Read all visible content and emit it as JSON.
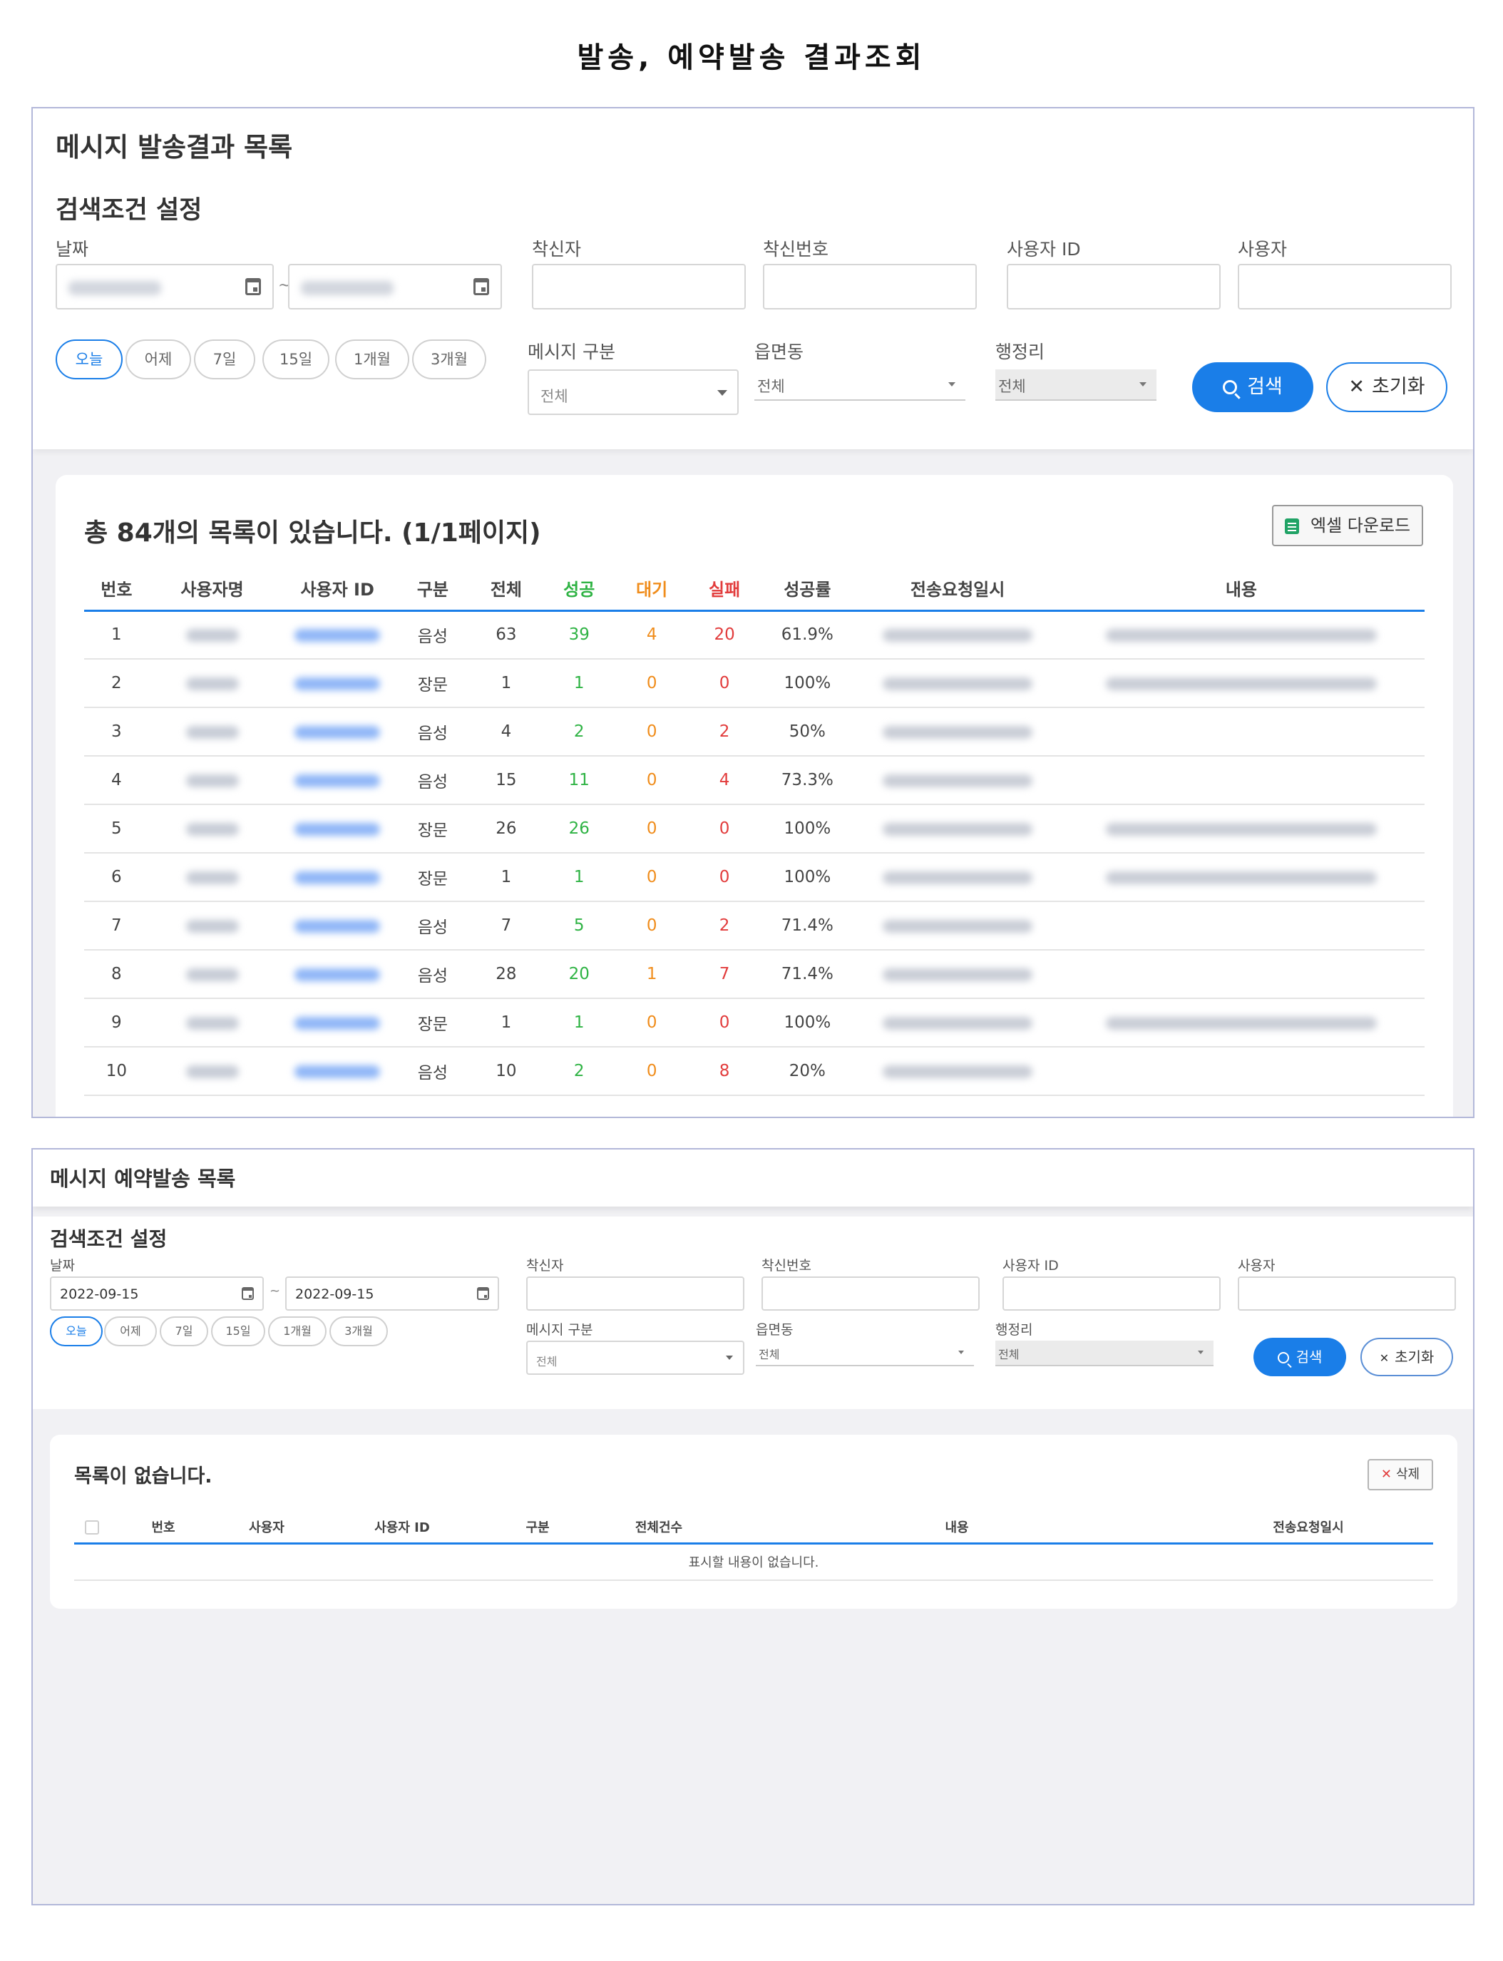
{
  "doc_title": "발송, 예약발송 결과조회",
  "sent": {
    "list_title": "메시지 발송결과 목록",
    "cond_title": "검색조건 설정",
    "labels": {
      "date": "날짜",
      "receiver": "착신자",
      "receiver_no": "착신번호",
      "user_id": "사용자 ID",
      "user": "사용자",
      "msg_type": "메시지 구분",
      "town": "읍면동",
      "village": "행정리"
    },
    "date_sep": "~",
    "quick_ranges": [
      "오늘",
      "어제",
      "7일",
      "15일",
      "1개월",
      "3개월"
    ],
    "selects": {
      "msg_type": "전체",
      "town": "전체",
      "village": "전체"
    },
    "search_label": "검색",
    "reset_label": "초기화",
    "reset_glyph": "✕",
    "total_text": "총 84개의 목록이 있습니다. (1/1페이지)",
    "excel_label": "엑셀 다운로드",
    "columns": [
      "번호",
      "사용자명",
      "사용자 ID",
      "구분",
      "전체",
      "성공",
      "대기",
      "실패",
      "성공률",
      "전송요청일시",
      "내용"
    ],
    "rows": [
      {
        "no": "1",
        "type": "음성",
        "total": "63",
        "success": "39",
        "wait": "4",
        "fail": "20",
        "rate": "61.9%",
        "has_content": true
      },
      {
        "no": "2",
        "type": "장문",
        "total": "1",
        "success": "1",
        "wait": "0",
        "fail": "0",
        "rate": "100%",
        "has_content": true
      },
      {
        "no": "3",
        "type": "음성",
        "total": "4",
        "success": "2",
        "wait": "0",
        "fail": "2",
        "rate": "50%",
        "has_content": false
      },
      {
        "no": "4",
        "type": "음성",
        "total": "15",
        "success": "11",
        "wait": "0",
        "fail": "4",
        "rate": "73.3%",
        "has_content": false
      },
      {
        "no": "5",
        "type": "장문",
        "total": "26",
        "success": "26",
        "wait": "0",
        "fail": "0",
        "rate": "100%",
        "has_content": true
      },
      {
        "no": "6",
        "type": "장문",
        "total": "1",
        "success": "1",
        "wait": "0",
        "fail": "0",
        "rate": "100%",
        "has_content": true
      },
      {
        "no": "7",
        "type": "음성",
        "total": "7",
        "success": "5",
        "wait": "0",
        "fail": "2",
        "rate": "71.4%",
        "has_content": false
      },
      {
        "no": "8",
        "type": "음성",
        "total": "28",
        "success": "20",
        "wait": "1",
        "fail": "7",
        "rate": "71.4%",
        "has_content": false
      },
      {
        "no": "9",
        "type": "장문",
        "total": "1",
        "success": "1",
        "wait": "0",
        "fail": "0",
        "rate": "100%",
        "has_content": true
      },
      {
        "no": "10",
        "type": "음성",
        "total": "10",
        "success": "2",
        "wait": "0",
        "fail": "8",
        "rate": "20%",
        "has_content": false
      }
    ]
  },
  "reserved": {
    "list_title": "메시지 예약발송 목록",
    "cond_title": "검색조건 설정",
    "labels": {
      "date": "날짜",
      "receiver": "착신자",
      "receiver_no": "착신번호",
      "user_id": "사용자 ID",
      "user": "사용자",
      "msg_type": "메시지 구분",
      "town": "읍면동",
      "village": "행정리"
    },
    "date_from": "2022-09-15",
    "date_to": "2022-09-15",
    "date_sep": "~",
    "quick_ranges": [
      "오늘",
      "어제",
      "7일",
      "15일",
      "1개월",
      "3개월"
    ],
    "selects": {
      "msg_type": "전체",
      "town": "전체",
      "village": "전체"
    },
    "search_label": "검색",
    "reset_label": "초기화",
    "reset_glyph": "✕",
    "empty_title": "목록이 없습니다.",
    "delete_label": "삭제",
    "delete_glyph": "✕",
    "columns": [
      "번호",
      "사용자",
      "사용자 ID",
      "구분",
      "전체건수",
      "내용",
      "전송요청일시"
    ],
    "empty_row": "표시할 내용이 없습니다."
  },
  "colors": {
    "accent": "#1a7ee8",
    "success": "#2fb344",
    "wait": "#f08d1c",
    "fail": "#e23c3c",
    "frame_border": "#b3b8d9"
  }
}
